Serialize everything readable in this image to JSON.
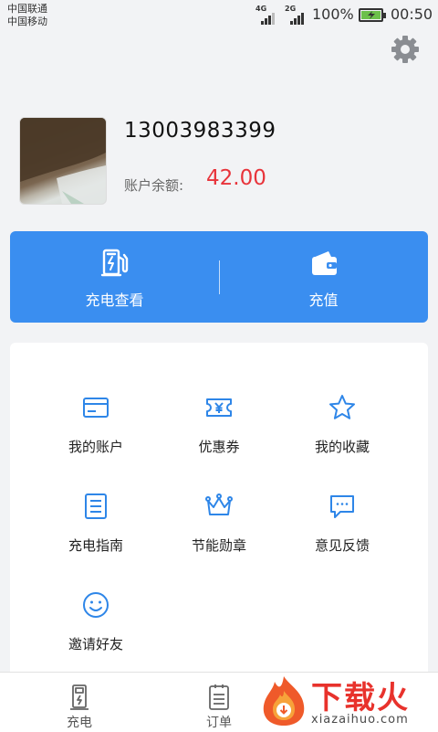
{
  "status_bar": {
    "carrier_1": "中国联通",
    "carrier_2": "中国移动",
    "network_1": "4G",
    "network_2": "2G",
    "battery_percent": "100%",
    "time": "00:50"
  },
  "header": {
    "settings_icon": "gear-icon"
  },
  "profile": {
    "phone": "13003983399",
    "balance_label": "账户余额:",
    "balance_value": "42.00"
  },
  "actions": [
    {
      "label": "充电查看",
      "icon": "charging-station-icon"
    },
    {
      "label": "充值",
      "icon": "wallet-icon"
    }
  ],
  "menu": [
    {
      "label": "我的账户",
      "icon": "card-icon"
    },
    {
      "label": "优惠券",
      "icon": "coupon-icon"
    },
    {
      "label": "我的收藏",
      "icon": "star-icon"
    },
    {
      "label": "充电指南",
      "icon": "guide-icon"
    },
    {
      "label": "节能勋章",
      "icon": "crown-icon"
    },
    {
      "label": "意见反馈",
      "icon": "feedback-icon"
    },
    {
      "label": "邀请好友",
      "icon": "smile-icon"
    }
  ],
  "bottom_nav": [
    {
      "label": "充电",
      "icon": "charger-icon"
    },
    {
      "label": "订单",
      "icon": "order-icon"
    }
  ],
  "watermark": {
    "title": "下载火",
    "url": "xiazaihuo.com"
  },
  "colors": {
    "accent": "#3a8ef0",
    "balance": "#e8343b",
    "icon": "#2e86e8",
    "background": "#f2f3f5"
  }
}
